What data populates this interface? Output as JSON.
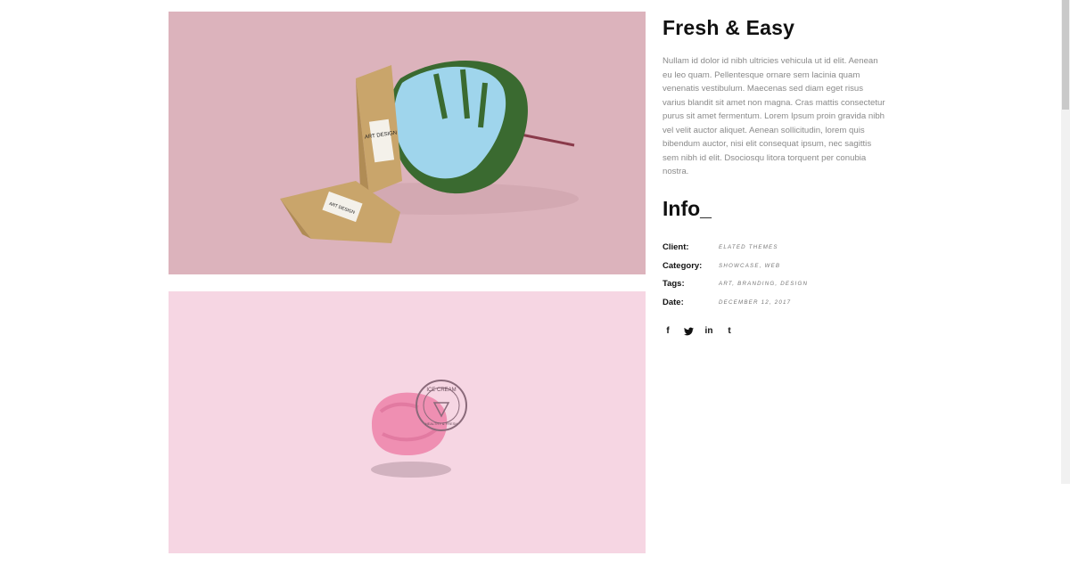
{
  "project": {
    "title": "Fresh & Easy",
    "description": "Nullam id dolor id nibh ultricies vehicula ut id elit. Aenean eu leo quam. Pellentesque ornare sem lacinia quam venenatis vestibulum. Maecenas sed diam eget risus varius blandit sit amet non magna. Cras mattis consectetur purus sit amet fermentum. Lorem Ipsum proin gravida nibh vel velit auctor aliquet. Aenean sollicitudin, lorem quis bibendum auctor, nisi elit consequat ipsum, nec sagittis sem nibh id elit. Dsociosqu litora torquent per conubia nostra."
  },
  "info": {
    "heading": "Info_",
    "rows": [
      {
        "label": "Client:",
        "value": "ELATED THEMES"
      },
      {
        "label": "Category:",
        "value": "SHOWCASE, WEB"
      },
      {
        "label": "Tags:",
        "value": "ART, BRANDING, DESIGN"
      },
      {
        "label": "Date:",
        "value": "DECEMBER 12, 2017"
      }
    ]
  },
  "social": {
    "facebook": "f",
    "twitter": "t",
    "linkedin": "in",
    "tumblr": "t"
  },
  "images": {
    "image1": {
      "bg": "#dcb3bc",
      "pouch_label_1": "ART DESIGN",
      "pouch_label_2": "ART DESIGN"
    },
    "image2": {
      "bg": "#f6d6e3",
      "badge_top": "ICE CREAM",
      "badge_bottom": "HEALTHY & FRESH"
    }
  }
}
